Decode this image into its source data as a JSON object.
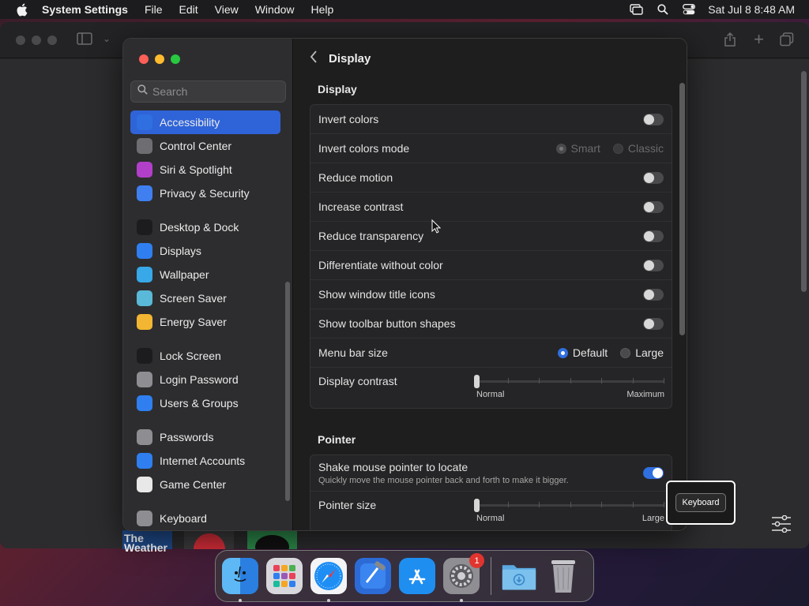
{
  "menubar": {
    "app_name": "System Settings",
    "items": [
      "File",
      "Edit",
      "View",
      "Window",
      "Help"
    ],
    "clock": "Sat Jul 8  8:48 AM"
  },
  "sidebar": {
    "search_placeholder": "Search",
    "groups": [
      [
        {
          "label": "Accessibility",
          "icon": "accessibility-icon",
          "color": "#2f6fe0",
          "active": true
        },
        {
          "label": "Control Center",
          "icon": "control-center-icon",
          "color": "#6e6e72"
        },
        {
          "label": "Siri & Spotlight",
          "icon": "siri-icon",
          "color": "#b23fc8"
        },
        {
          "label": "Privacy & Security",
          "icon": "hand-icon",
          "color": "#3f7ff0"
        }
      ],
      [
        {
          "label": "Desktop & Dock",
          "icon": "dock-icon",
          "color": "#1c1c1e"
        },
        {
          "label": "Displays",
          "icon": "displays-icon",
          "color": "#2f7ff0"
        },
        {
          "label": "Wallpaper",
          "icon": "wallpaper-icon",
          "color": "#38a8e8"
        },
        {
          "label": "Screen Saver",
          "icon": "screen-saver-icon",
          "color": "#5ab8d8"
        },
        {
          "label": "Energy Saver",
          "icon": "energy-icon",
          "color": "#f2b632"
        }
      ],
      [
        {
          "label": "Lock Screen",
          "icon": "lock-icon",
          "color": "#1c1c1e"
        },
        {
          "label": "Login Password",
          "icon": "password-icon",
          "color": "#8e8e92"
        },
        {
          "label": "Users & Groups",
          "icon": "users-icon",
          "color": "#2f7ff0"
        }
      ],
      [
        {
          "label": "Passwords",
          "icon": "key-icon",
          "color": "#8e8e92"
        },
        {
          "label": "Internet Accounts",
          "icon": "at-icon",
          "color": "#2f7ff0"
        },
        {
          "label": "Game Center",
          "icon": "game-center-icon",
          "color": "#e8e8e8"
        }
      ],
      [
        {
          "label": "Keyboard",
          "icon": "keyboard-icon",
          "color": "#8e8e92"
        }
      ]
    ]
  },
  "main": {
    "title": "Display",
    "display_section": {
      "title": "Display",
      "invert_colors": {
        "label": "Invert colors",
        "on": false
      },
      "invert_mode": {
        "label": "Invert colors mode",
        "options": [
          "Smart",
          "Classic"
        ],
        "selected": "Smart"
      },
      "reduce_motion": {
        "label": "Reduce motion",
        "on": false
      },
      "increase_contrast": {
        "label": "Increase contrast",
        "on": false
      },
      "reduce_transparency": {
        "label": "Reduce transparency",
        "on": false
      },
      "differentiate": {
        "label": "Differentiate without color",
        "on": false
      },
      "title_icons": {
        "label": "Show window title icons",
        "on": false
      },
      "toolbar_shapes": {
        "label": "Show toolbar button shapes",
        "on": false
      },
      "menu_bar_size": {
        "label": "Menu bar size",
        "options": [
          "Default",
          "Large"
        ],
        "selected": "Default"
      },
      "display_contrast": {
        "label": "Display contrast",
        "min_label": "Normal",
        "max_label": "Maximum",
        "value": 0
      }
    },
    "pointer_section": {
      "title": "Pointer",
      "shake": {
        "label": "Shake mouse pointer to locate",
        "sub": "Quickly move the mouse pointer back and forth to make it bigger.",
        "on": true
      },
      "pointer_size": {
        "label": "Pointer size",
        "min_label": "Normal",
        "max_label": "Large",
        "value": 0
      }
    }
  },
  "tooltip": {
    "label": "Keyboard"
  },
  "dock": {
    "apps": [
      "Finder",
      "Launchpad",
      "Safari",
      "Xcode",
      "App Store",
      "System Settings"
    ],
    "badge": "1",
    "extras": [
      "Downloads",
      "Trash"
    ]
  }
}
